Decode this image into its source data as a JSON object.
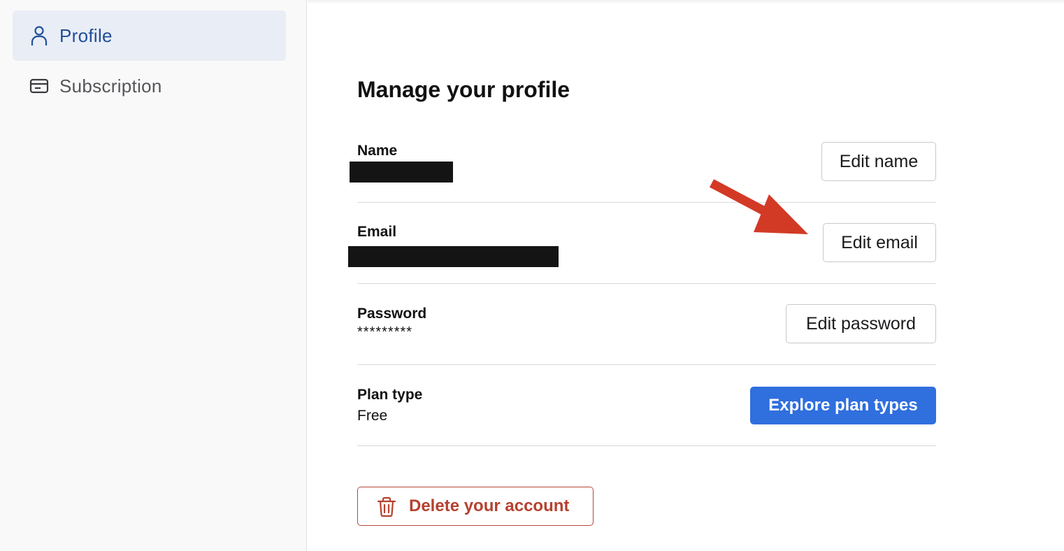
{
  "sidebar": {
    "items": [
      {
        "label": "Profile",
        "icon": "user-icon",
        "active": true
      },
      {
        "label": "Subscription",
        "icon": "credit-card-icon",
        "active": false
      }
    ]
  },
  "main": {
    "title": "Manage your profile",
    "rows": {
      "name": {
        "label": "Name",
        "value_redacted": true,
        "button": "Edit name"
      },
      "email": {
        "label": "Email",
        "value_redacted": true,
        "button": "Edit email"
      },
      "password": {
        "label": "Password",
        "value": "*********",
        "button": "Edit password"
      },
      "plan": {
        "label": "Plan type",
        "value": "Free",
        "button": "Explore plan types"
      }
    },
    "delete_button": "Delete your account"
  },
  "annotation": {
    "type": "arrow",
    "color": "#d23a26",
    "points_to": "Edit email"
  },
  "colors": {
    "accent": "#2f6fde",
    "active_nav_bg": "#e9edf5",
    "active_nav_text": "#1f4f9a",
    "danger": "#b5412f"
  }
}
